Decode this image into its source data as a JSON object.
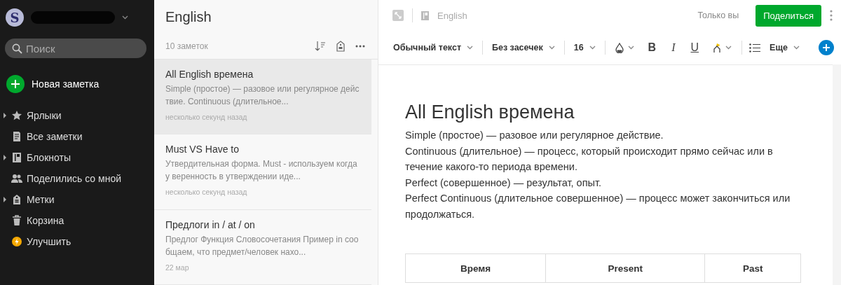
{
  "account": {
    "avatar_letter": "S"
  },
  "search": {
    "placeholder": "Поиск"
  },
  "new_note": {
    "label": "Новая заметка"
  },
  "sidebar": {
    "items": [
      {
        "label": "Ярлыки",
        "expandable": true
      },
      {
        "label": "Все заметки",
        "expandable": false
      },
      {
        "label": "Блокноты",
        "expandable": true
      },
      {
        "label": "Поделились со мной",
        "expandable": false
      },
      {
        "label": "Метки",
        "expandable": true
      },
      {
        "label": "Корзина",
        "expandable": false
      },
      {
        "label": "Улучшить",
        "expandable": false
      }
    ]
  },
  "note_list": {
    "title": "English",
    "count": "10 заметок",
    "notes": [
      {
        "title": "All English времена",
        "snippet": "Simple (простое) — разовое или регулярное дейс твие. Continuous (длительное...",
        "time": "несколько секунд назад",
        "selected": true
      },
      {
        "title": "Must VS Have to",
        "snippet": "Утвердительная форма. Must - используем когда у веренность в утверждении иде...",
        "time": "несколько секунд назад",
        "selected": false
      },
      {
        "title": "Предлоги in / at / on",
        "snippet": "Предлог Функция Словосочетания Пример in соо бщаем, что предмет/человек нахо...",
        "time": "22 мар",
        "selected": false
      }
    ]
  },
  "editor": {
    "notebook": "English",
    "sharing": "Только вы",
    "share_button": "Поделиться",
    "toolbar": [
      {
        "kind": "dropdown",
        "label": "Обычный текст"
      },
      {
        "kind": "divider"
      },
      {
        "kind": "dropdown",
        "label": "Без засечек"
      },
      {
        "kind": "divider"
      },
      {
        "kind": "dropdown",
        "label": "16"
      },
      {
        "kind": "divider"
      },
      {
        "kind": "color"
      },
      {
        "kind": "format",
        "label": "B"
      },
      {
        "kind": "format",
        "label": "I"
      },
      {
        "kind": "format",
        "label": "U"
      },
      {
        "kind": "highlight"
      },
      {
        "kind": "divider"
      },
      {
        "kind": "list"
      },
      {
        "kind": "dropdown",
        "label": "Еще"
      }
    ],
    "title": "All English времена",
    "paragraphs": [
      "Simple (простое) — разовое или регулярное действие.",
      "Continuous (длительное) — процесс, который происходит прямо сейчас или в течение какого-то периода времени.",
      "Perfect (совершенное) — результат, опыт.",
      "Perfect Continuous (длительное совершенное) — процесс может закончиться или продолжаться."
    ],
    "table": {
      "columns": [
        "Время",
        "Present",
        "Past"
      ]
    }
  }
}
